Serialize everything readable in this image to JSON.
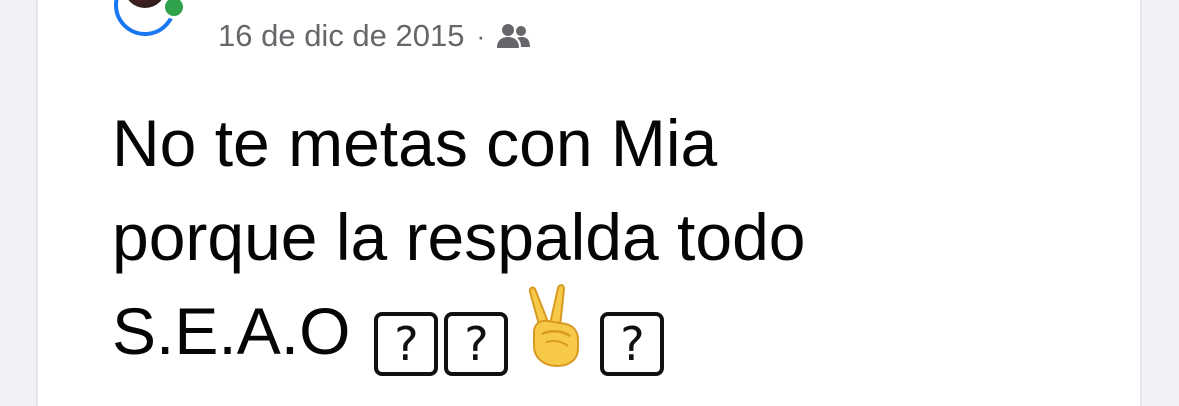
{
  "post": {
    "date": "16 de dic de 2015",
    "separator": "·",
    "audience_icon": "friends-icon",
    "text_lines": [
      "No te metas con Mia",
      "porque la respalda todo",
      "S.E.A.O"
    ],
    "emoji_sequence": [
      "?",
      "?",
      "victory-hand-emoji",
      "?"
    ]
  },
  "colors": {
    "background": "#f0f2f5",
    "card": "#ffffff",
    "meta_text": "#65676b",
    "post_text": "#050505",
    "story_ring": "#1877f2",
    "online_dot": "#31a24c"
  }
}
